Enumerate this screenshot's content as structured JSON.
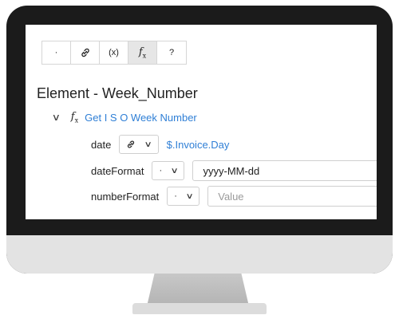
{
  "toolbar": {
    "buttons": [
      {
        "label": "·",
        "icon": "dot-icon"
      },
      {
        "label": "⚭",
        "icon": "link-icon"
      },
      {
        "label": "(x)",
        "icon": "variable-icon"
      },
      {
        "label": "fx",
        "icon": "function-icon"
      },
      {
        "label": "?",
        "icon": "help-icon"
      }
    ]
  },
  "element": {
    "title": "Element - Week_Number"
  },
  "function": {
    "name": "Get I S O Week Number",
    "params": [
      {
        "label": "date",
        "type_icon": "⚭",
        "value": "$.Invoice.Day"
      },
      {
        "label": "dateFormat",
        "type_icon": "·",
        "value": "yyyy-MM-dd"
      },
      {
        "label": "numberFormat",
        "type_icon": "·",
        "placeholder": "Value"
      }
    ]
  },
  "colors": {
    "accent": "#2f7fd6",
    "bezel": "#1b1b1b",
    "chin": "#e3e3e3"
  }
}
